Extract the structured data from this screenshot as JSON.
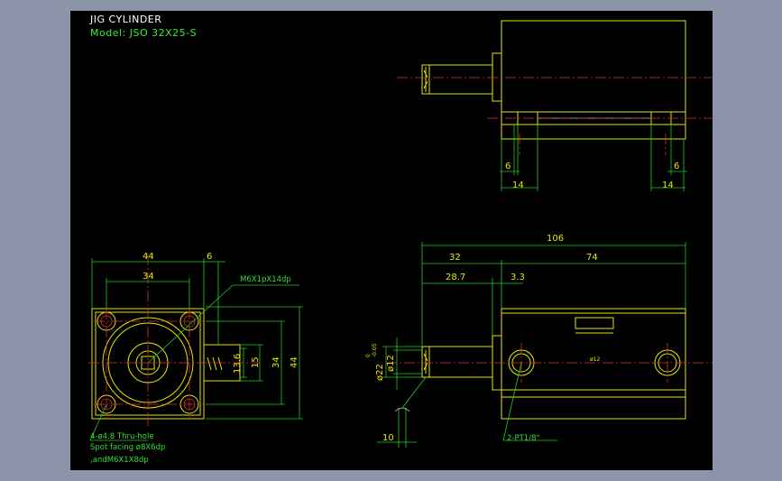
{
  "title": "JIG CYLINDER",
  "model": "Model: JSO 32X25-S",
  "dims": {
    "d106": "106",
    "d32": "32",
    "d74": "74",
    "d28_7": "28.7",
    "d3_3": "3.3",
    "d44_top": "44",
    "d6_top": "6",
    "d34_top": "34",
    "d13_6": "13.6",
    "d15": "15",
    "d34_side": "34",
    "d44_side": "44",
    "d6_left": "6",
    "d14_left": "14",
    "d6_right": "6",
    "d14_right": "14",
    "d10": "10",
    "d12": "ø12",
    "d22": "ø22",
    "d22_tol_top": "0",
    "d22_tol_bot": "-0.05",
    "d12_small": "ø12"
  },
  "notes": {
    "m6": "M6X1pX14dp",
    "hole1": "4-ø4.8 Thru-hole",
    "hole2": "Spot facing ø8X6dp",
    "hole3": ",andM6X1X8dp",
    "port": "2-PT1/8\""
  }
}
